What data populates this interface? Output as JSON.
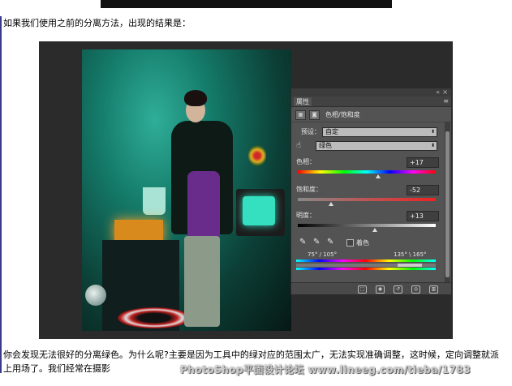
{
  "article": {
    "intro": "如果我们使用之前的分离方法，出现的结果是：",
    "body": "你会发现无法很好的分离绿色。为什么呢?主要是因为工具中的绿对应的范围太广，无法实现准确调整，这时候，定向调整就派上用场了。我们经常在摄影",
    "watermark": "PhotoShop平面设计论坛 www.lineeg.com/tieba/1783"
  },
  "panel": {
    "tab_label": "属性",
    "title": "色相/饱和度",
    "preset_label": "预设：",
    "preset_value": "自定",
    "channel_value": "绿色",
    "hue_label": "色相：",
    "hue_value": "+17",
    "saturation_label": "饱和度：",
    "saturation_value": "-52",
    "lightness_label": "明度：",
    "lightness_value": "+13",
    "colorize_label": "着色",
    "range_left": "75° / 105°",
    "range_right": "135° \\ 165°",
    "colors": {
      "panel_bg": "#535353",
      "canvas_bg": "#2b2b2b",
      "photo_teal": "#147a69"
    }
  }
}
